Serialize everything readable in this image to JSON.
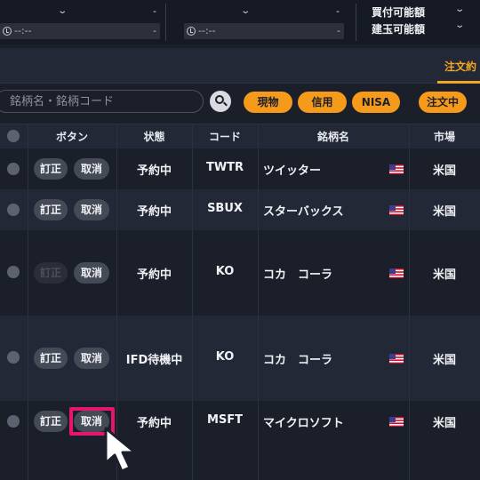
{
  "summary": {
    "col1": {
      "value": "",
      "dash": "-",
      "time_placeholder": "--:--",
      "time_dash": "-"
    },
    "col2": {
      "value": "",
      "dash": "-",
      "time_placeholder": "--:--",
      "time_dash": "-"
    },
    "buying_power_label": "買付可能額",
    "position_label": "建玉可能額"
  },
  "tabs": {
    "active_label": "注文約"
  },
  "search": {
    "placeholder": "銘柄名・銘柄コード",
    "chips": [
      "現物",
      "信用",
      "NISA",
      "注文中"
    ]
  },
  "table": {
    "headers": {
      "button": "ボタン",
      "status": "状態",
      "code": "コード",
      "name": "銘柄名",
      "market": "市場"
    },
    "rows": [
      {
        "edit": "訂正",
        "cancel": "取消",
        "edit_enabled": true,
        "status": "予約中",
        "code": "TWTR",
        "name": "ツイッター",
        "market": "米国",
        "flag": "us-flag-icon"
      },
      {
        "edit": "訂正",
        "cancel": "取消",
        "edit_enabled": true,
        "status": "予約中",
        "code": "SBUX",
        "name": "スターバックス",
        "market": "米国",
        "flag": "us-flag-icon"
      },
      {
        "edit": "訂正",
        "cancel": "取消",
        "edit_enabled": false,
        "status": "予約中",
        "code": "KO",
        "name": "コカ　コーラ",
        "market": "米国",
        "flag": "us-flag-icon"
      },
      {
        "edit": "訂正",
        "cancel": "取消",
        "edit_enabled": true,
        "status": "IFD待機中",
        "code": "KO",
        "name": "コカ　コーラ",
        "market": "米国",
        "flag": "us-flag-icon"
      },
      {
        "edit": "訂正",
        "cancel": "取消",
        "edit_enabled": true,
        "status": "予約中",
        "code": "MSFT",
        "name": "マイクロソフト",
        "market": "米国",
        "flag": "us-flag-icon"
      }
    ]
  },
  "colors": {
    "accent": "#f59a1b",
    "highlight": "#e6166f",
    "background": "#1b1f2a"
  }
}
